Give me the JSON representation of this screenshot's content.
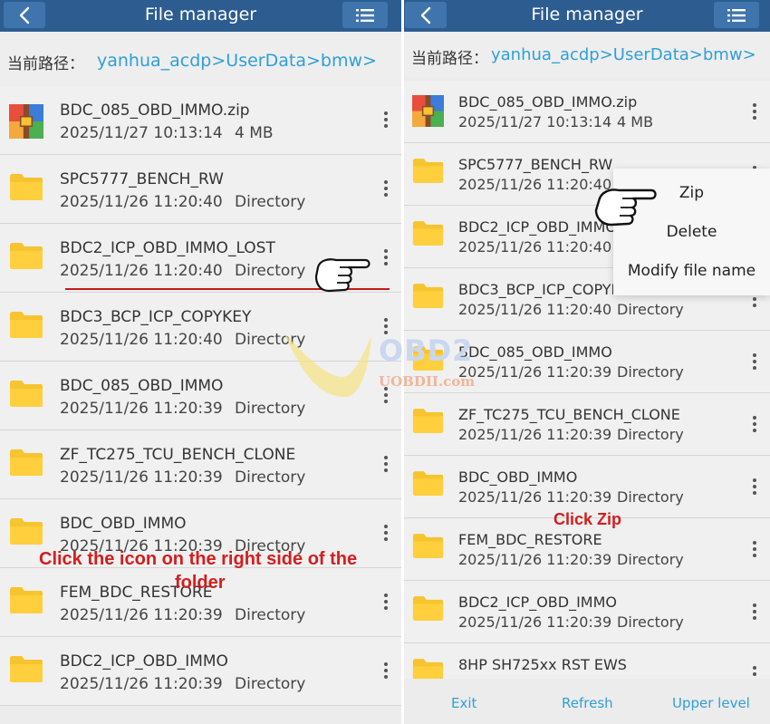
{
  "left_panel": {
    "title": "File manager",
    "path_label": "当前路径：",
    "path_value": "yanhua_acdp>UserData>bmw>",
    "files": [
      {
        "name": "BDC_085_OBD_IMMO.zip",
        "date": "2025/11/27 10:13:14",
        "kind": "4 MB",
        "icon": "zip-icon"
      },
      {
        "name": "SPC5777_BENCH_RW",
        "date": "2025/11/26 11:20:40",
        "kind": "Directory",
        "icon": "folder-icon"
      },
      {
        "name": "BDC2_ICP_OBD_IMMO_LOST",
        "date": "2025/11/26 11:20:40",
        "kind": "Directory",
        "icon": "folder-icon"
      },
      {
        "name": "BDC3_BCP_ICP_COPYKEY",
        "date": "2025/11/26 11:20:40",
        "kind": "Directory",
        "icon": "folder-icon"
      },
      {
        "name": "BDC_085_OBD_IMMO",
        "date": "2025/11/26 11:20:39",
        "kind": "Directory",
        "icon": "folder-icon"
      },
      {
        "name": "ZF_TC275_TCU_BENCH_CLONE",
        "date": "2025/11/26 11:20:39",
        "kind": "Directory",
        "icon": "folder-icon"
      },
      {
        "name": "BDC_OBD_IMMO",
        "date": "2025/11/26 11:20:39",
        "kind": "Directory",
        "icon": "folder-icon"
      },
      {
        "name": "FEM_BDC_RESTORE",
        "date": "2025/11/26 11:20:39",
        "kind": "Directory",
        "icon": "folder-icon"
      },
      {
        "name": "BDC2_ICP_OBD_IMMO",
        "date": "2025/11/26 11:20:39",
        "kind": "Directory",
        "icon": "folder-icon"
      }
    ],
    "annotation": [
      "Click the icon on the right side of the",
      "folder"
    ]
  },
  "right_panel": {
    "title": "File manager",
    "path_label": "当前路径：",
    "path_value": "yanhua_acdp>UserData>bmw>",
    "files": [
      {
        "name": "BDC_085_OBD_IMMO.zip",
        "date": "2025/11/27 10:13:14",
        "kind": "4 MB",
        "icon": "zip-icon"
      },
      {
        "name": "SPC5777_BENCH_RW",
        "date": "2025/11/26 11:20:40",
        "kind": "",
        "icon": "folder-icon"
      },
      {
        "name": "BDC2_ICP_OBD_IMMO_L",
        "date": "2025/11/26 11:20:40",
        "kind": "",
        "icon": "folder-icon"
      },
      {
        "name": "BDC3_BCP_ICP_COPYKE",
        "date": "2025/11/26 11:20:40",
        "kind": "Directory",
        "icon": "folder-icon"
      },
      {
        "name": "BDC_085_OBD_IMMO",
        "date": "2025/11/26 11:20:39",
        "kind": "Directory",
        "icon": "folder-icon"
      },
      {
        "name": "ZF_TC275_TCU_BENCH_CLONE",
        "date": "2025/11/26 11:20:39",
        "kind": "Directory",
        "icon": "folder-icon"
      },
      {
        "name": "BDC_OBD_IMMO",
        "date": "2025/11/26 11:20:39",
        "kind": "Directory",
        "icon": "folder-icon"
      },
      {
        "name": "FEM_BDC_RESTORE",
        "date": "2025/11/26 11:20:39",
        "kind": "Directory",
        "icon": "folder-icon"
      },
      {
        "name": "BDC2_ICP_OBD_IMMO",
        "date": "2025/11/26 11:20:39",
        "kind": "Directory",
        "icon": "folder-icon"
      },
      {
        "name": "8HP SH725xx RST EWS",
        "date": "",
        "kind": "",
        "icon": "folder-icon"
      }
    ],
    "context_menu": [
      "Zip",
      "Delete",
      "Modify file name"
    ],
    "annotation": "Click Zip",
    "footer": {
      "exit": "Exit",
      "refresh": "Refresh",
      "upper": "Upper level"
    }
  },
  "watermark": {
    "brand": "OBD2",
    "site": "UOBDII.com"
  },
  "colors": {
    "titlebar": "#2d5d90",
    "button": "#3f74ad",
    "path": "#2f9fd6",
    "folder": "#f6c42e",
    "annotation": "#d21e1e",
    "underline": "#c41a1a"
  }
}
